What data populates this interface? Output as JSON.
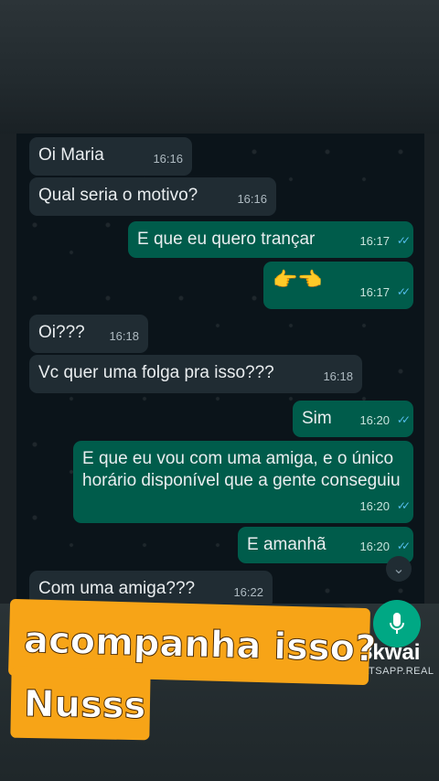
{
  "chat": {
    "messages": [
      {
        "dir": "in",
        "text": "Oi Maria",
        "time": "16:16"
      },
      {
        "dir": "in",
        "text": "Qual seria o motivo?",
        "time": "16:16"
      },
      {
        "dir": "out",
        "text": "E que eu quero trançar",
        "time": "16:17"
      },
      {
        "dir": "out",
        "text": "👉👈",
        "time": "16:17"
      },
      {
        "dir": "in",
        "text": "Oi???",
        "time": "16:18"
      },
      {
        "dir": "in",
        "text": "Vc quer uma folga pra isso???",
        "time": "16:18"
      },
      {
        "dir": "out",
        "text": "Sim",
        "time": "16:20"
      },
      {
        "dir": "out",
        "text": "E que eu vou com uma amiga, e o único horário disponível que a gente conseguiu",
        "time": "16:20"
      },
      {
        "dir": "out",
        "text": "E amanhã",
        "time": "16:20"
      },
      {
        "dir": "in",
        "text": "Com uma amiga???",
        "time": "16:22"
      }
    ]
  },
  "watermark": {
    "brand": "kwai",
    "sub": "ATSAPP.REAL"
  },
  "caption": {
    "line1": "acompanha isso?",
    "line2": "Nusss"
  },
  "colors": {
    "incoming": "#202c33",
    "outgoing": "#005c4b",
    "accent": "#00a884",
    "caption_bg": "#f7a417"
  },
  "icons": [
    "attach-icon",
    "camera-icon",
    "mic-icon",
    "chevron-down-icon",
    "double-check-icon"
  ]
}
